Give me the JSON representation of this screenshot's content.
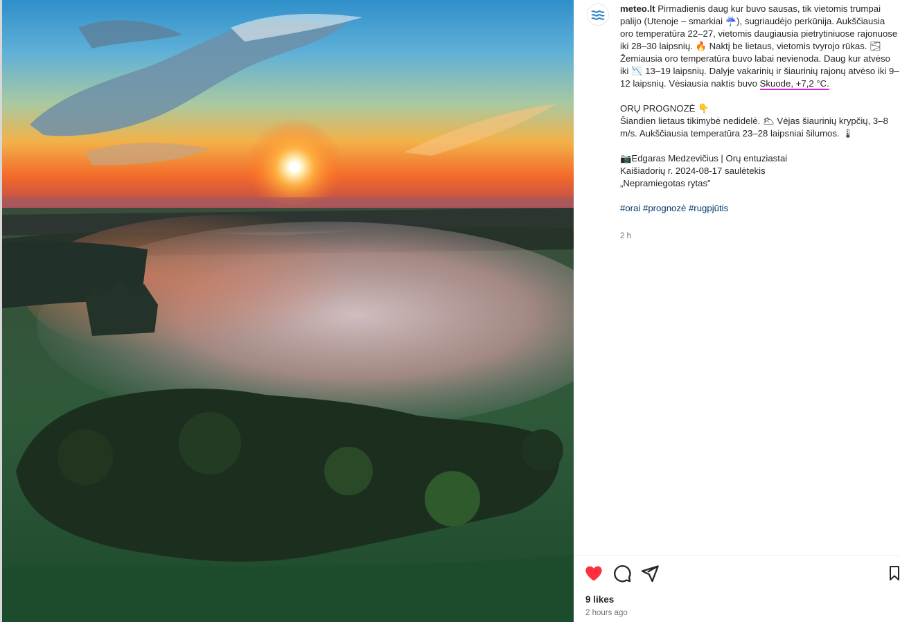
{
  "photo": {
    "description_icon": "sunrise-fog-forest-photo"
  },
  "post": {
    "username": "meteo.lt",
    "caption_p1_a": "Pirmadienis daug kur buvo sausas, tik vietomis trumpai palijo (Utenoje – smarkiai ☔), sugriaudėjo perkūnija. Aukščiausia oro temperatūra 22–27, vietomis daugiausia pietrytiniuose rajonuose iki 28–30 laipsnių. 🔥 Naktį be lietaus, vietomis tvyrojo rūkas. 🌫 Žemiausia oro temperatūra buvo labai nevienoda. Daug kur atvėso iki 📉 13–19 laipsnių. Dalyje vakarinių ir šiaurinių rajonų atvėso iki 9–12 laipsnių. Vėsiausia naktis buvo ",
    "caption_p1_hl": "Skuode, +7,2 °C.",
    "caption_p2": "ORŲ PROGNOZĖ 👇\nŠiandien lietaus tikimybė nedidelė. 🌥 Vėjas šiaurinių krypčių, 3–8 m/s. Aukščiausia temperatūra 23–28 laipsniai šilumos. 🌡",
    "caption_p3": "📷Edgaras Medzevičius | Orų entuziastai\nKaišiadorių r. 2024-08-17 saulėtekis\n„Nepramiegotas rytas\"",
    "hashtags": "#orai #prognozė #rugpjūtis",
    "relative_time": "2 h"
  },
  "footer": {
    "likes": "9 likes",
    "time": "2 hours ago"
  },
  "colors": {
    "like_red": "#ff3040",
    "highlight_magenta": "#e020e0",
    "link_blue": "#00376b"
  }
}
